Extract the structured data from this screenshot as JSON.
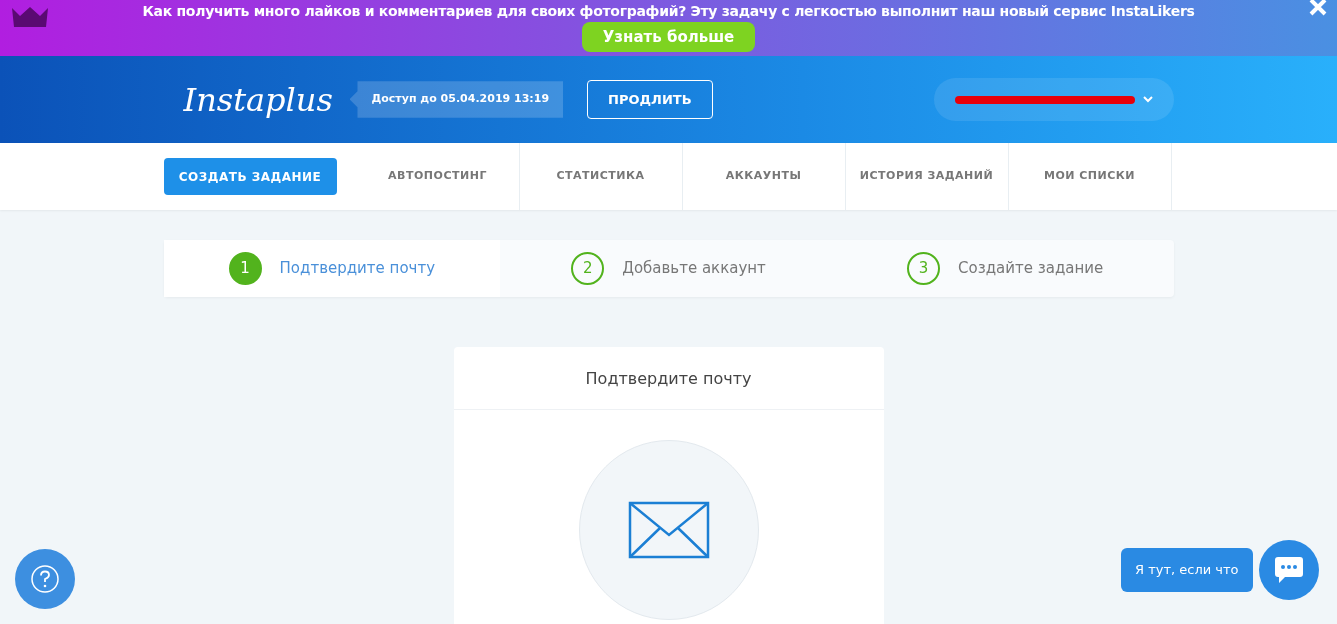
{
  "banner": {
    "text": "Как получить много лайков и комментариев для своих фотографий? Эту задачу с легкостью выполнит наш новый сервис InstaLikers",
    "button": "Узнать больше"
  },
  "header": {
    "logo": "Instaplus",
    "access": "Доступ до 05.04.2019 13:19",
    "renew_button": "ПРОДЛИТЬ",
    "account": {
      "redacted": true
    }
  },
  "nav": [
    {
      "label": "СОЗДАТЬ ЗАДАНИЕ",
      "kind": "primary"
    },
    {
      "label": "АВТОПОСТИНГ",
      "kind": "link"
    },
    {
      "label": "СТАТИСТИКА",
      "kind": "link"
    },
    {
      "label": "АККАУНТЫ",
      "kind": "link"
    },
    {
      "label": "ИСТОРИЯ ЗАДАНИЙ",
      "kind": "link"
    },
    {
      "label": "МОИ СПИСКИ",
      "kind": "link"
    }
  ],
  "steps": [
    {
      "number": "1",
      "label": "Подтвердите почту",
      "selected": true
    },
    {
      "number": "2",
      "label": "Добавьте аккаунт",
      "selected": false
    },
    {
      "number": "3",
      "label": "Создайте задание",
      "selected": false
    }
  ],
  "card": {
    "title": "Подтвердите почту"
  },
  "chat": {
    "bubble": "Я тут, если что"
  }
}
